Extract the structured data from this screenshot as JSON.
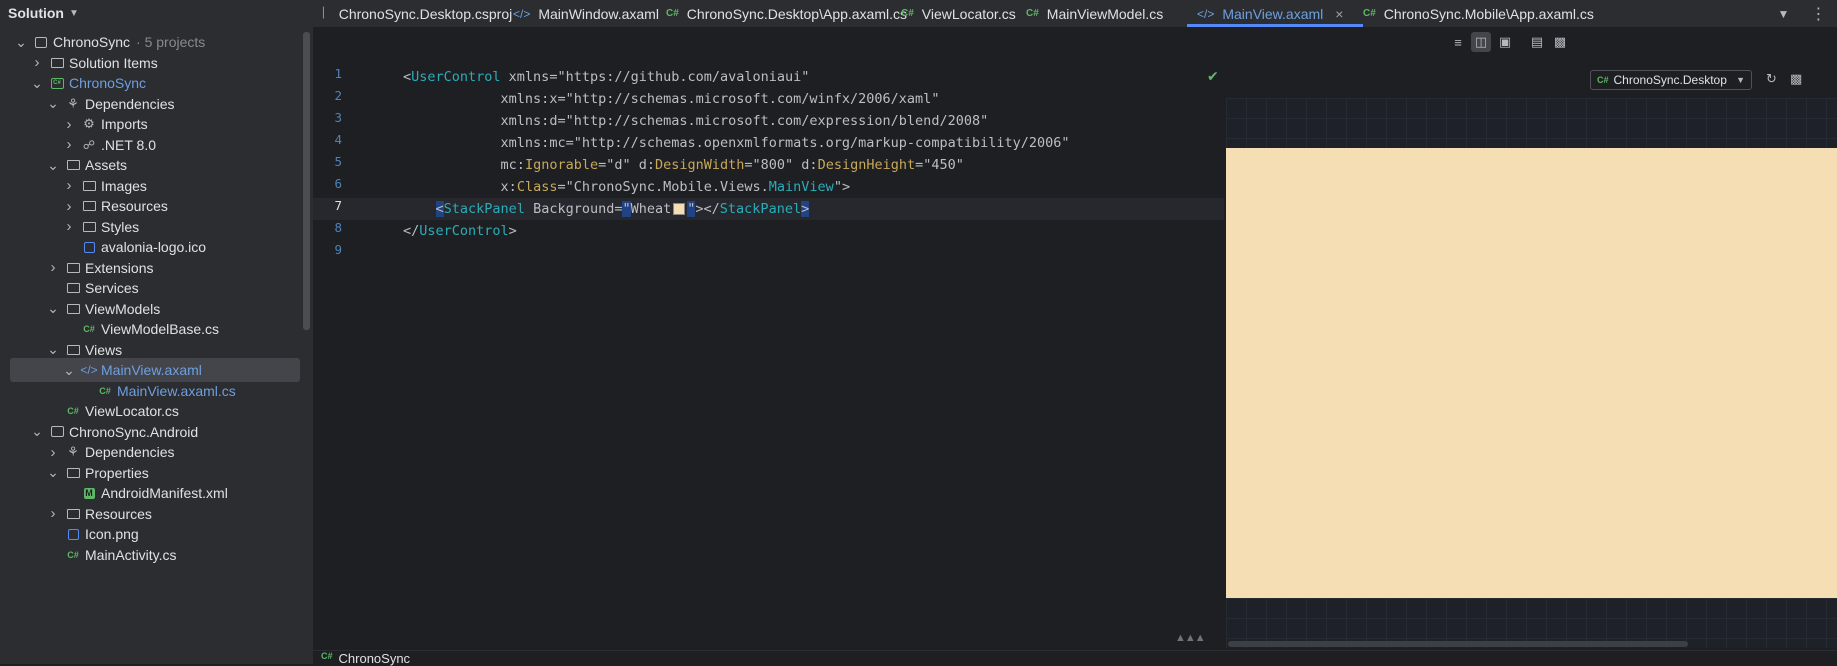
{
  "sidebar": {
    "title": "Solution",
    "tree": [
      {
        "label": "ChronoSync",
        "suffix": "5 projects",
        "icon": "solution-icon",
        "level": 0,
        "expanded": true
      },
      {
        "label": "Solution Items",
        "icon": "folder-icon",
        "level": 1,
        "expanded": false
      },
      {
        "label": "ChronoSync",
        "icon": "csharp-project-icon",
        "level": 1,
        "expanded": true,
        "highlight": true
      },
      {
        "label": "Dependencies",
        "icon": "dependencies-icon",
        "level": 2,
        "expanded": true
      },
      {
        "label": "Imports",
        "icon": "gear-icon",
        "level": 3,
        "expanded": false
      },
      {
        "label": ".NET 8.0",
        "icon": "framework-icon",
        "level": 3,
        "expanded": false
      },
      {
        "label": "Assets",
        "icon": "folder-icon",
        "level": 2,
        "expanded": true
      },
      {
        "label": "Images",
        "icon": "folder-icon",
        "level": 3,
        "expanded": false
      },
      {
        "label": "Resources",
        "icon": "folder-icon",
        "level": 3,
        "expanded": false
      },
      {
        "label": "Styles",
        "icon": "folder-icon",
        "level": 3,
        "expanded": false
      },
      {
        "label": "avalonia-logo.ico",
        "icon": "image-file-icon",
        "level": 3,
        "leaf": true
      },
      {
        "label": "Extensions",
        "icon": "folder-icon",
        "level": 2,
        "expanded": false
      },
      {
        "label": "Services",
        "icon": "folder-icon",
        "level": 2,
        "leaf": true
      },
      {
        "label": "ViewModels",
        "icon": "folder-icon",
        "level": 2,
        "expanded": true
      },
      {
        "label": "ViewModelBase.cs",
        "icon": "csharp-file-icon",
        "level": 3,
        "leaf": true
      },
      {
        "label": "Views",
        "icon": "folder-icon",
        "level": 2,
        "expanded": true
      },
      {
        "label": "MainView.axaml",
        "icon": "xaml-file-icon",
        "level": 3,
        "expanded": true,
        "selected": true,
        "highlight": true
      },
      {
        "label": "MainView.axaml.cs",
        "icon": "csharp-file-icon",
        "level": 4,
        "leaf": true,
        "highlight": true
      },
      {
        "label": "ViewLocator.cs",
        "icon": "csharp-file-icon",
        "level": 2,
        "leaf": true
      },
      {
        "label": "ChronoSync.Android",
        "icon": "android-project-icon",
        "level": 1,
        "expanded": true
      },
      {
        "label": "Dependencies",
        "icon": "dependencies-icon",
        "level": 2,
        "expanded": false
      },
      {
        "label": "Properties",
        "icon": "folder-icon",
        "level": 2,
        "expanded": true
      },
      {
        "label": "AndroidManifest.xml",
        "icon": "manifest-file-icon",
        "level": 3,
        "leaf": true
      },
      {
        "label": "Resources",
        "icon": "folder-icon",
        "level": 2,
        "expanded": false
      },
      {
        "label": "Icon.png",
        "icon": "image-file-icon",
        "level": 2,
        "leaf": true
      },
      {
        "label": "MainActivity.cs",
        "icon": "csharp-file-icon",
        "level": 2,
        "leaf": true
      }
    ]
  },
  "tabs": [
    {
      "label": "ChronoSync.Desktop.csproj",
      "icon": "csproj-icon",
      "active": false
    },
    {
      "label": "MainWindow.axaml",
      "icon": "xaml-file-icon",
      "active": false
    },
    {
      "label": "ChronoSync.Desktop\\App.axaml.cs",
      "icon": "csharp-file-icon",
      "active": false
    },
    {
      "label": "ViewLocator.cs",
      "icon": "csharp-file-icon",
      "active": false
    },
    {
      "label": "MainViewModel.cs",
      "icon": "csharp-file-icon",
      "active": false
    },
    {
      "label": "MainView.axaml",
      "icon": "xaml-file-icon",
      "active": true
    },
    {
      "label": "ChronoSync.Mobile\\App.axaml.cs",
      "icon": "csharp-file-icon",
      "active": false
    }
  ],
  "editor": {
    "line_numbers": [
      "1",
      "2",
      "3",
      "4",
      "5",
      "6",
      "7",
      "8",
      "9"
    ],
    "current_line": 7,
    "code": {
      "l1_tag": "UserControl",
      "l1_attr": " xmlns=\"https://github.com/avaloniaui\"",
      "l2": "xmlns:x=\"http://schemas.microsoft.com/winfx/2006/xaml\"",
      "l3": "xmlns:d=\"http://schemas.microsoft.com/expression/blend/2008\"",
      "l4": "xmlns:mc=\"http://schemas.openxmlformats.org/markup-compatibility/2006\"",
      "l5_a": "mc:",
      "l5_b": "Ignorable",
      "l5_c": "=\"d\" d:",
      "l5_d": "DesignWidth",
      "l5_e": "=\"800\" d:",
      "l5_f": "DesignHeight",
      "l5_g": "=\"450\"",
      "l6_a": "x:",
      "l6_b": "Class",
      "l6_c": "=\"ChronoSync.Mobile.Views.",
      "l6_d": "MainView",
      "l6_e": "\">",
      "l7_tag": "StackPanel",
      "l7_attr": " Background=",
      "l7_value": "Wheat",
      "l7_close": "StackPanel",
      "l8_tag": "UserControl"
    },
    "toolbar_icons": [
      "code-view-icon",
      "split-view-icon",
      "preview-view-icon",
      "layout-icon",
      "terminal-icon"
    ]
  },
  "preview": {
    "target": "ChronoSync.Desktop",
    "background_color": "#F5DEB3"
  },
  "status": {
    "project": "ChronoSync"
  },
  "colors": {
    "accent": "#548af7",
    "tag": "#2aacb8",
    "attr_name": "#c8a85a",
    "csharp": "#5fb865"
  }
}
